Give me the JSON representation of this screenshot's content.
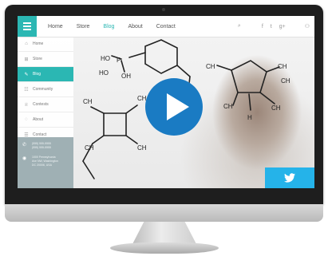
{
  "colors": {
    "accent": "#2bb7b3",
    "play_button": "#1a7bc3",
    "twitter": "#25b3e9",
    "contact_panel": "#9fb0b4",
    "monitor_bezel": "#1e1e1e"
  },
  "header": {
    "menu_icon": "hamburger-icon",
    "nav": [
      {
        "label": "Home"
      },
      {
        "label": "Store"
      },
      {
        "label": "Blog",
        "active": true
      },
      {
        "label": "About"
      },
      {
        "label": "Contact"
      }
    ],
    "icons": {
      "search": "⌕",
      "facebook": "f",
      "twitter": "t",
      "google": "g+",
      "user": "⚇"
    }
  },
  "sidebar": {
    "items": [
      {
        "label": "Home",
        "icon": "⌂"
      },
      {
        "label": "Store",
        "icon": "⊞"
      },
      {
        "label": "Blog",
        "icon": "✎",
        "active": true
      },
      {
        "label": "Community",
        "icon": "☷"
      },
      {
        "label": "Contests",
        "icon": "♕"
      },
      {
        "label": "About",
        "icon": "◌"
      },
      {
        "label": "Contact",
        "icon": "☰"
      }
    ],
    "contact": {
      "phone_icon": "✆",
      "phone_lines": [
        "(555) 555-5555",
        "(555) 555-5555"
      ],
      "location_icon": "◉",
      "address_lines": [
        "1000 Pennsylvania",
        "Ave NW, Washington",
        "DC 20006, USA"
      ]
    }
  },
  "video": {
    "play_icon": "play-icon"
  },
  "social": {
    "twitter_icon": "twitter-bird-icon"
  }
}
